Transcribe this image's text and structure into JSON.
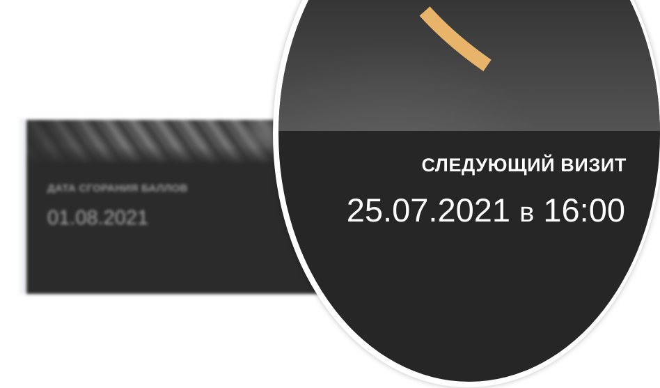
{
  "card": {
    "points_expiry_label": "ДАТА СГОРАНИЯ БАЛЛОВ",
    "points_expiry_date": "01.08.2021"
  },
  "magnifier": {
    "next_visit_label": "СЛЕДУЮЩИЙ ВИЗИТ",
    "next_visit_date": "25.07.2021",
    "next_visit_preposition": "в",
    "next_visit_time": "16:00"
  },
  "colors": {
    "card_background": "#2b2b2b",
    "lens_background": "#262626",
    "accent_arc": "#e8b46a",
    "text_primary": "#ffffff",
    "text_muted": "#9a9a9a"
  }
}
